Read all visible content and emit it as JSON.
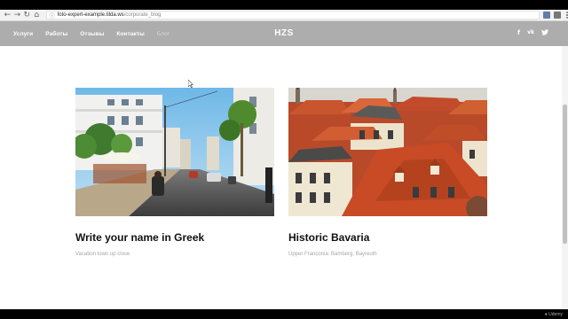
{
  "browser": {
    "url_host": "foto-expert-example.tilda.ws",
    "url_path": "/corporate_blog",
    "back_glyph": "←",
    "forward_glyph": "→",
    "reload_glyph": "↻",
    "home_glyph": "⌂",
    "lock_glyph": "ⓘ"
  },
  "header": {
    "nav": [
      "Услуги",
      "Работы",
      "Отзывы",
      "Контакты",
      "Блог"
    ],
    "logo": "HZS",
    "socials": [
      "f",
      "vk",
      "tw"
    ],
    "bg_color": "#adadad"
  },
  "cards": [
    {
      "title": "Write your name in Greek",
      "description": "Vacation town up close"
    },
    {
      "title": "Historic Bavaria",
      "description": "Upper Franconia: Bamberg, Bayreuth"
    }
  ],
  "watermark": "● Udemy"
}
